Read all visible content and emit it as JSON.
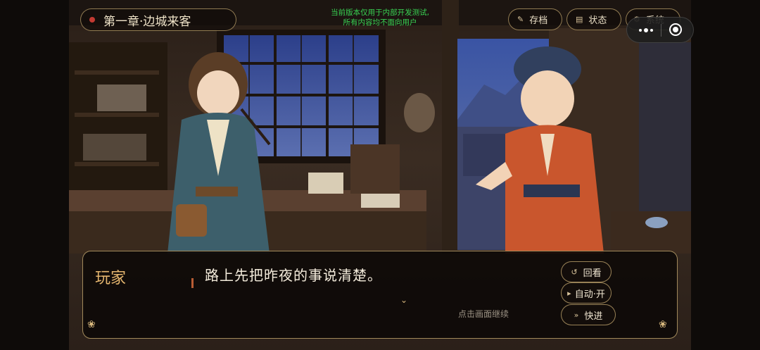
{
  "chapter": {
    "title": "第一章·边城来客"
  },
  "notice": {
    "line1": "当前版本仅用于内部开发测试,",
    "line2": "所有内容均不面向用户"
  },
  "top_menu": {
    "save_label": "存档",
    "status_label": "状态",
    "system_label": "系统",
    "save_icon": "brush-icon",
    "status_icon": "scroll-icon",
    "system_icon": "gear-icon"
  },
  "capsule": {
    "more_icon": "more-dots-icon",
    "close_icon": "target-icon"
  },
  "dialogue": {
    "speaker": "玩家",
    "text": "路上先把昨夜的事说清楚。",
    "continue_hint": "点击画面继续"
  },
  "side_buttons": {
    "review_label": "回看",
    "auto_label": "自动·开",
    "skip_label": "快进"
  },
  "colors": {
    "accent_gold": "#d9b97e",
    "speaker_color": "#e5b66f",
    "notice_green": "#39d353",
    "chapter_dot": "#c23a32"
  }
}
